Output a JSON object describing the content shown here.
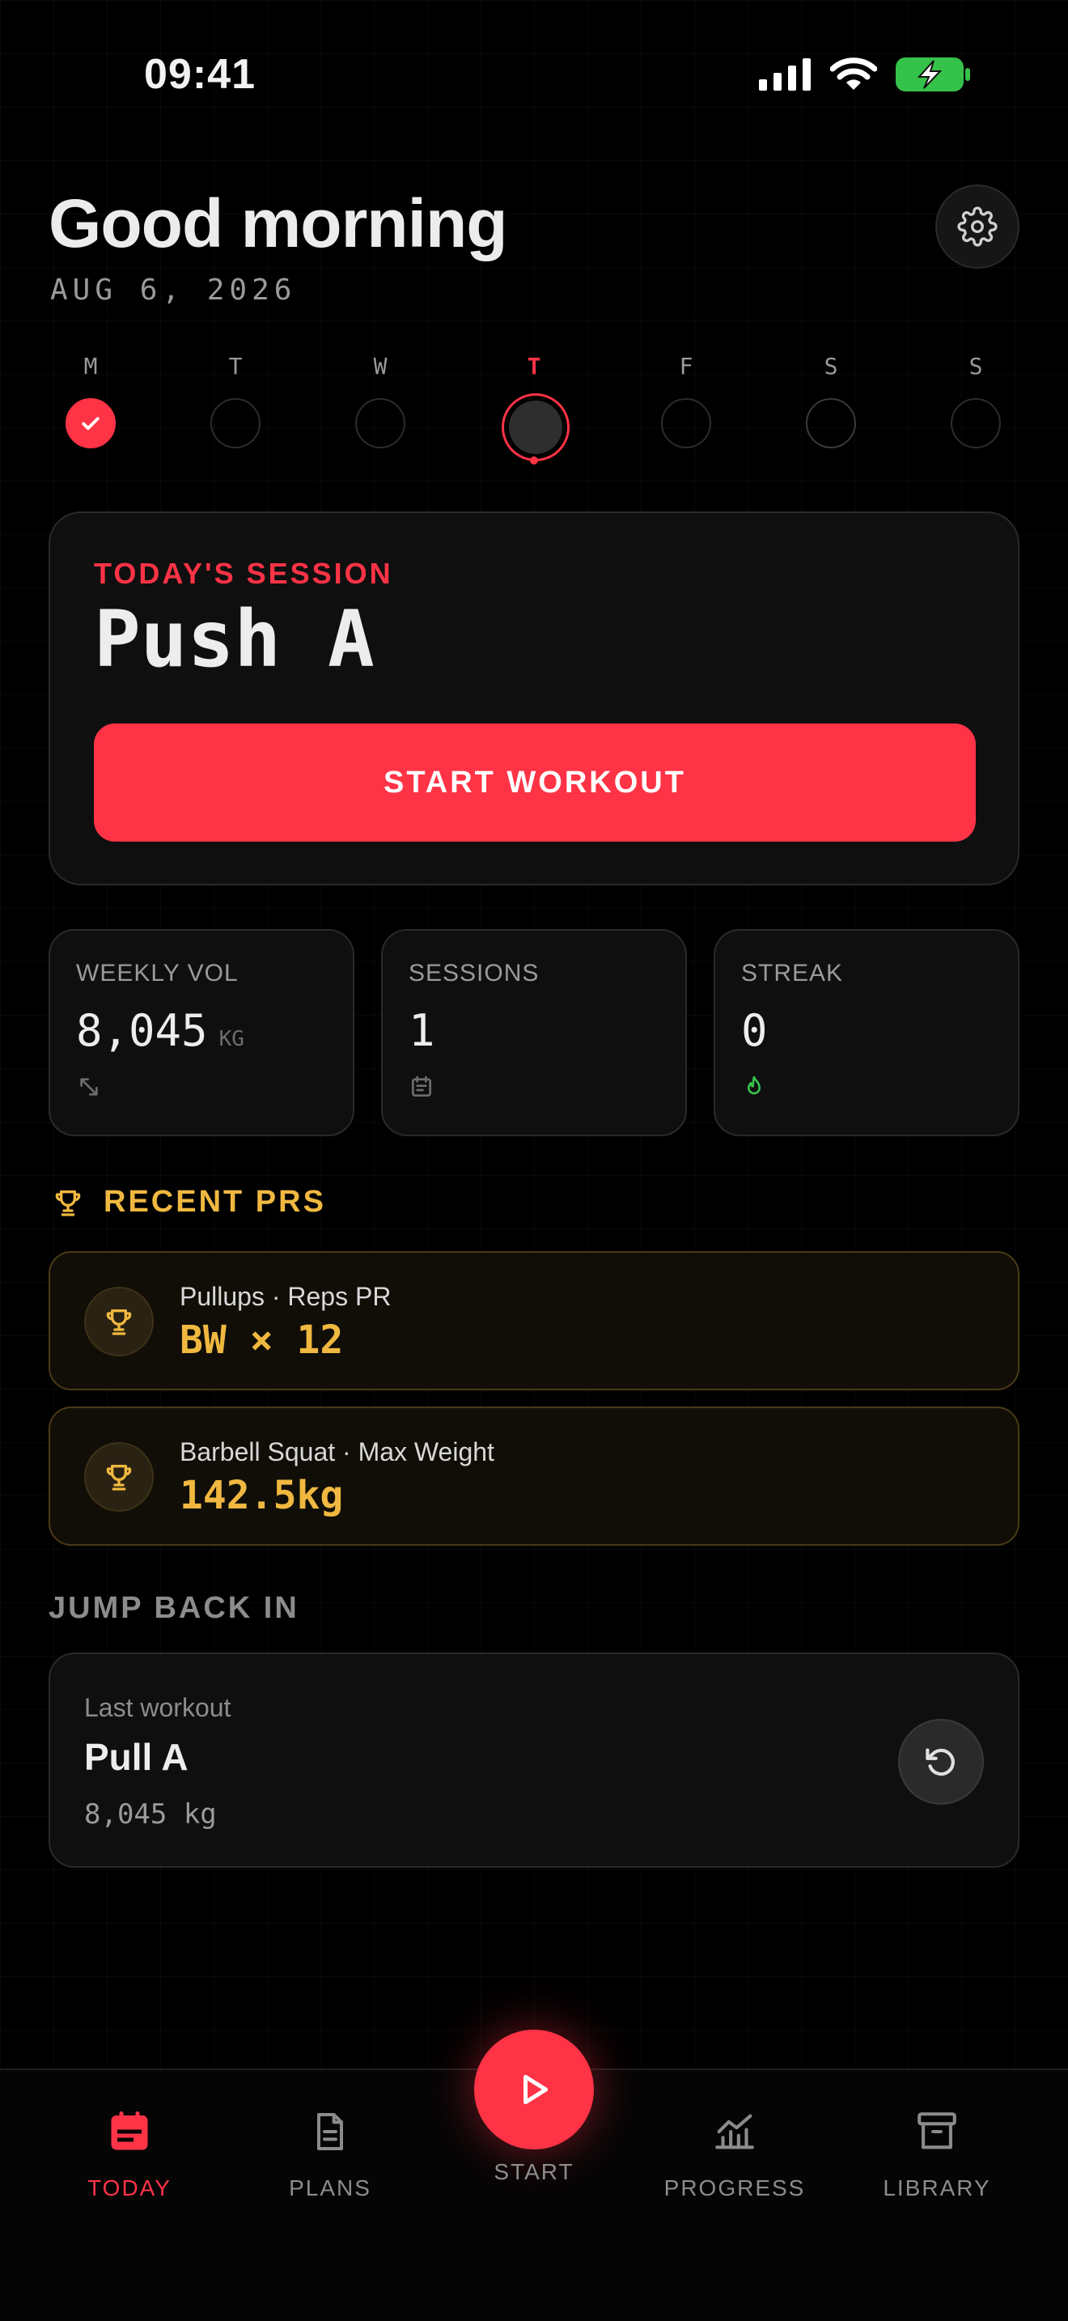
{
  "status_bar": {
    "time": "09:41"
  },
  "header": {
    "greeting": "Good morning",
    "date": "AUG 6, 2026"
  },
  "week": [
    {
      "letter": "M",
      "state": "done"
    },
    {
      "letter": "T",
      "state": "empty"
    },
    {
      "letter": "W",
      "state": "empty"
    },
    {
      "letter": "T",
      "state": "today"
    },
    {
      "letter": "F",
      "state": "empty"
    },
    {
      "letter": "S",
      "state": "empty"
    },
    {
      "letter": "S",
      "state": "empty"
    }
  ],
  "session": {
    "label": "TODAY'S SESSION",
    "name": "Push A",
    "start_label": "START WORKOUT"
  },
  "stats": [
    {
      "label": "WEEKLY VOL",
      "value": "8,045",
      "unit": "KG",
      "icon": "arrows-diagonal-icon"
    },
    {
      "label": "SESSIONS",
      "value": "1",
      "unit": "",
      "icon": "calendar-icon"
    },
    {
      "label": "STREAK",
      "value": "0",
      "unit": "",
      "icon": "flame-icon"
    }
  ],
  "recent_prs": {
    "title": "RECENT PRS",
    "items": [
      {
        "meta": "Pullups · Reps PR",
        "value": "BW × 12"
      },
      {
        "meta": "Barbell Squat · Max Weight",
        "value": "142.5kg"
      }
    ]
  },
  "jump_back": {
    "title": "JUMP BACK IN",
    "label": "Last workout",
    "name": "Pull A",
    "volume": "8,045 kg"
  },
  "nav": {
    "today": "TODAY",
    "plans": "PLANS",
    "start": "START",
    "progress": "PROGRESS",
    "library": "LIBRARY"
  },
  "colors": {
    "accent": "#ff3346",
    "gold": "#f0b840",
    "green": "#35c24a",
    "background": "#000000"
  }
}
